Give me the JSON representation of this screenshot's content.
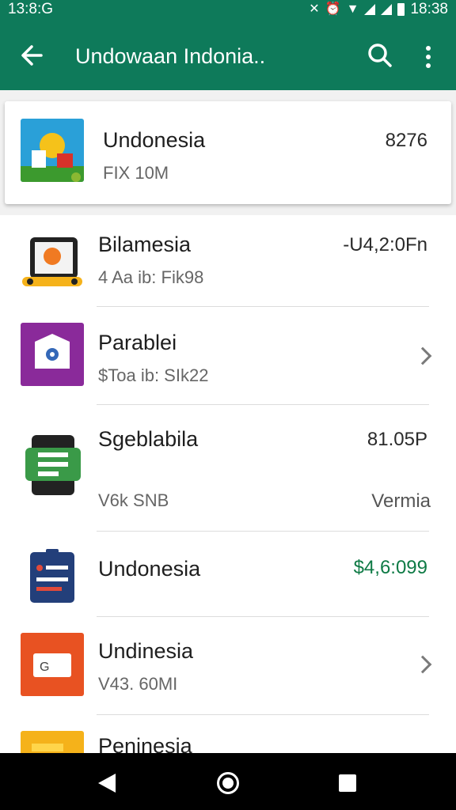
{
  "status_bar": {
    "time": "13:8:G",
    "clock": "18:38",
    "icons": [
      "nfc-icon",
      "alarm-icon",
      "wifi-icon",
      "signal-icon",
      "battery-icon"
    ]
  },
  "app_bar": {
    "title": "Undowaan Indonia..",
    "back_icon": "arrow-left-icon",
    "search_icon": "search-icon",
    "more_icon": "more-vert-icon"
  },
  "featured": {
    "title": "Undonesia",
    "subtitle": "FIX 10M",
    "value": "8276"
  },
  "items": [
    {
      "title": "Bilamesia",
      "subtitle": "4 Aa ib: Fik98",
      "value": "-U4,2:0Fn"
    },
    {
      "title": "Parablei",
      "subtitle": "$Toa ib: SIk22",
      "value": ""
    },
    {
      "title": "Sgeblabila",
      "subtitle": "V6k SNB",
      "value": "81.05P",
      "value2": "Vermia"
    },
    {
      "title": "Undonesia",
      "subtitle": "",
      "value": "$4,6:099"
    },
    {
      "title": "Undinesia",
      "subtitle": "V43. 60MI",
      "value": ""
    },
    {
      "title": "Peninesia",
      "subtitle": "",
      "value": ""
    }
  ],
  "thumb_labels": {
    "item5": "G"
  },
  "colors": {
    "primary": "#0e7a5a",
    "value_green": "#0e7a45"
  }
}
